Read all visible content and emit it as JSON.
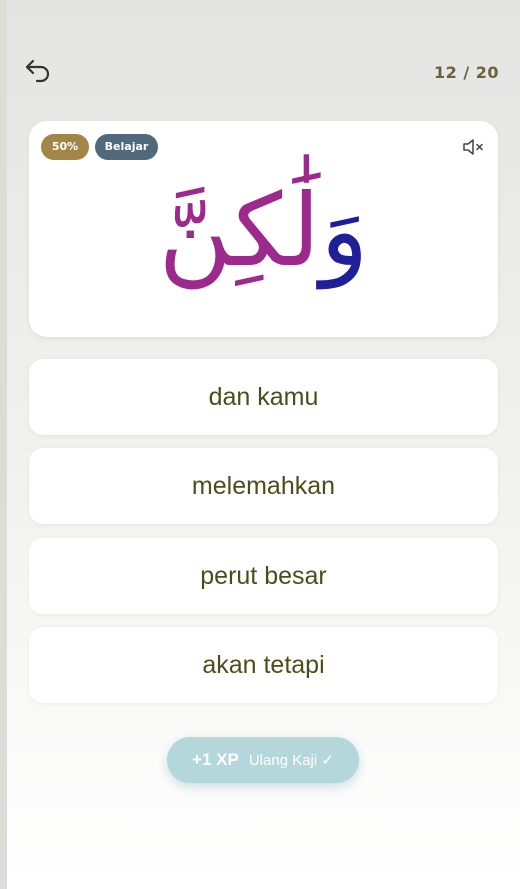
{
  "header": {
    "back_icon": "undo-arrow-icon",
    "progress_current": "12",
    "progress_total": "20",
    "progress_text": "12 / 20"
  },
  "card": {
    "mastery_badge": "50%",
    "mode_badge": "Belajar",
    "mute_icon": "speaker-muted-icon",
    "arabic_prefix": "وَ",
    "arabic_word": "لَٰكِنَّ",
    "colors": {
      "prefix": "#1f1f9a",
      "word": "#9c2a8c",
      "badge_mastery": "#a48548",
      "badge_mode": "#4e6a7b"
    }
  },
  "options": [
    {
      "label": "dan kamu"
    },
    {
      "label": "melemahkan"
    },
    {
      "label": "perut besar"
    },
    {
      "label": "akan tetapi"
    }
  ],
  "review_button": {
    "xp": "+1 XP",
    "label": "Ulang Kaji ✓",
    "color": "#b3d7da"
  }
}
